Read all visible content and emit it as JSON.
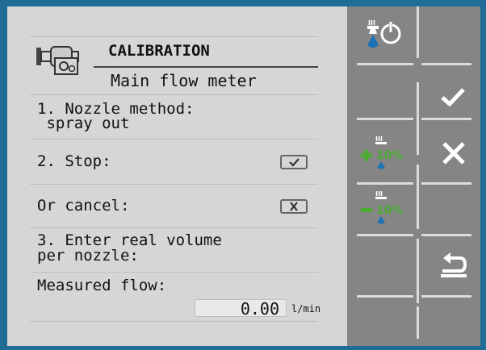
{
  "header": {
    "title": "CALIBRATION",
    "subtitle": "Main flow meter"
  },
  "steps": {
    "step1_line1": "1. Nozzle method:",
    "step1_line2": " spray out",
    "step2": "2. Stop:",
    "cancel": "Or cancel:",
    "step3_line1": "3. Enter real volume",
    "step3_line2": "per nozzle:"
  },
  "measured": {
    "label": "Measured flow:",
    "value": "0.00",
    "unit": "l/min"
  },
  "softkeys": {
    "percent_label": "10%",
    "roman_label": "III"
  },
  "colors": {
    "frame": "#1f6d96",
    "panel": "#d6d6d6",
    "softkey_bg": "#858585",
    "green": "#4cab33",
    "blue": "#1a73b6",
    "white": "#ffffff"
  }
}
